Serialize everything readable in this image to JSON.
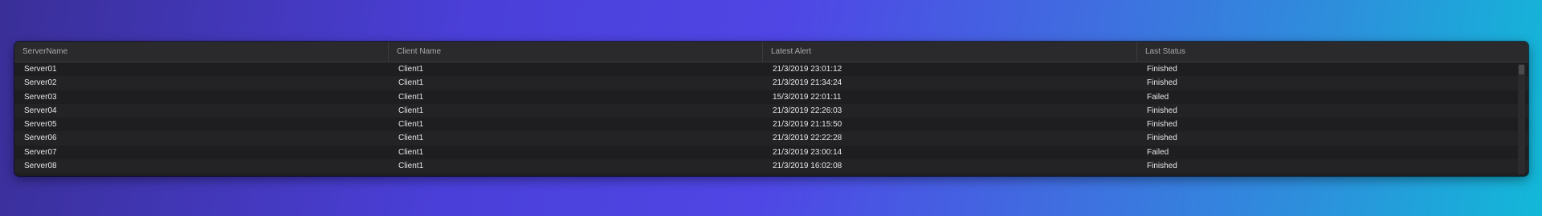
{
  "table": {
    "columns": [
      "ServerName",
      "Client Name",
      "Latest Alert",
      "Last Status"
    ],
    "rows": [
      [
        "Server01",
        "Client1",
        "21/3/2019 23:01:12",
        "Finished"
      ],
      [
        "Server02",
        "Client1",
        "21/3/2019 21:34:24",
        "Finished"
      ],
      [
        "Server03",
        "Client1",
        "15/3/2019 22:01:11",
        "Failed"
      ],
      [
        "Server04",
        "Client1",
        "21/3/2019 22:26:03",
        "Finished"
      ],
      [
        "Server05",
        "Client1",
        "21/3/2019 21:15:50",
        "Finished"
      ],
      [
        "Server06",
        "Client1",
        "21/3/2019 22:22:28",
        "Finished"
      ],
      [
        "Server07",
        "Client1",
        "21/3/2019 23:00:14",
        "Failed"
      ],
      [
        "Server08",
        "Client1",
        "21/3/2019 16:02:08",
        "Finished"
      ]
    ]
  }
}
